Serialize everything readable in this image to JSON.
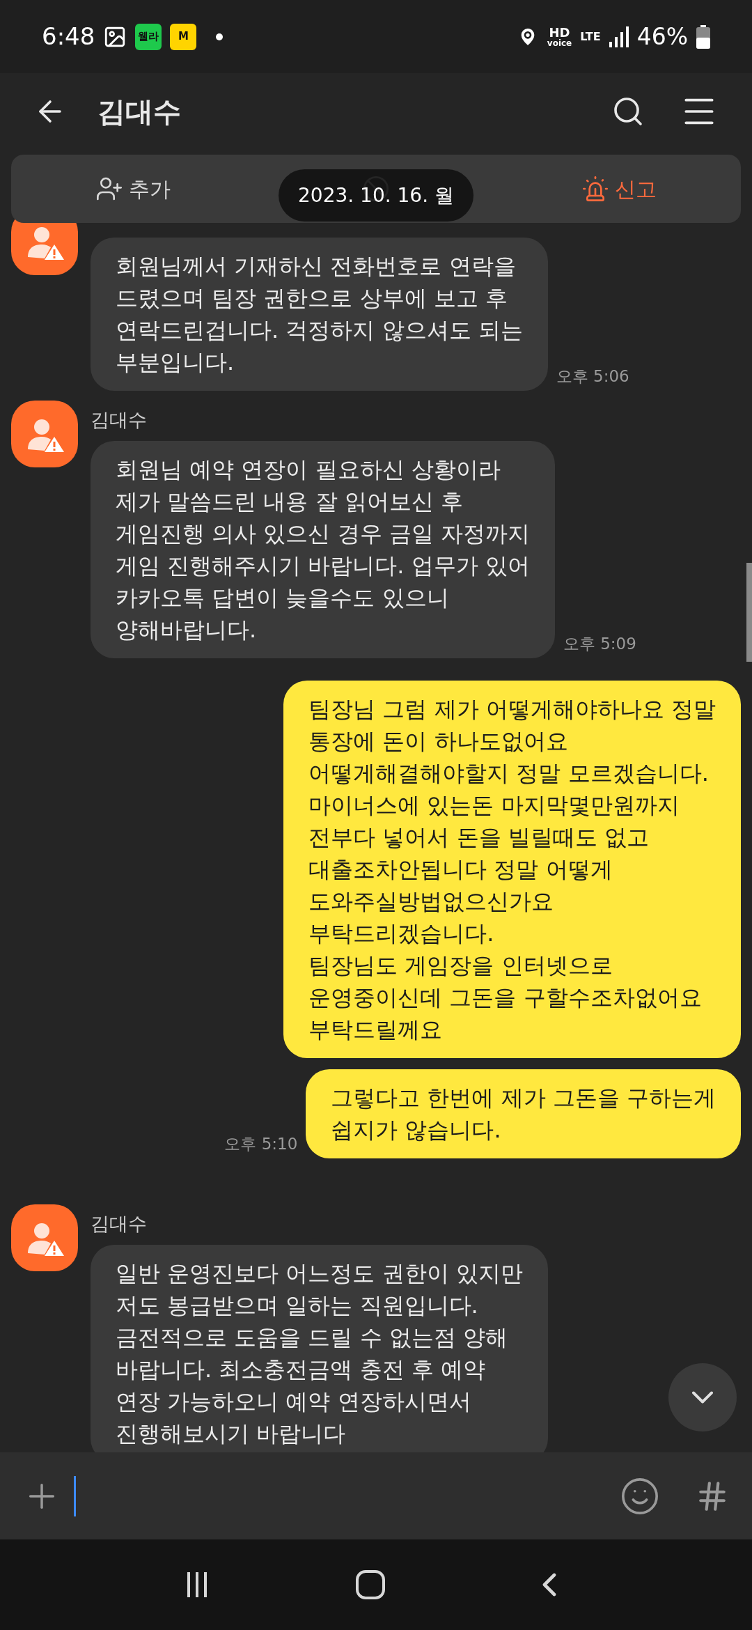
{
  "status_bar": {
    "time": "6:48",
    "notification_badges": [
      {
        "label": "웰라",
        "color": "#1ec94c"
      },
      {
        "label": "M",
        "color": "#ffd400"
      }
    ],
    "hd": "HD",
    "voice": "voice",
    "network": "LTE",
    "battery": "46%"
  },
  "header": {
    "title": "김대수"
  },
  "action_bar": [
    {
      "kind": "add",
      "label": "추가"
    },
    {
      "kind": "block"
    },
    {
      "kind": "report",
      "label": "신고"
    }
  ],
  "date_pill": "2023. 10. 16. 월",
  "messages": [
    {
      "kind": "other",
      "lines": [
        "회원님께서 기재하신 전화번호로 연락을",
        "드렸으며 팀장 권한으로 상부에 보고 후",
        "연락드린겁니다. 걱정하지 않으셔도 되는",
        "부분입니다."
      ],
      "time": "오후 5:06"
    },
    {
      "kind": "other",
      "name": "김대수",
      "lines": [
        "회원님 예약 연장이 필요하신 상황이라",
        "제가 말씀드린 내용 잘 읽어보신 후",
        "게임진행 의사 있으신 경우 금일 자정까지",
        "게임 진행해주시기 바랍니다. 업무가 있어",
        "카카오톡 답변이 늦을수도 있으니",
        "양해바랍니다."
      ],
      "time": "오후 5:09"
    },
    {
      "kind": "me",
      "lines": [
        "팀장님 그럼 제가 어떻게해야하나요 정말",
        "통장에 돈이 하나도없어요",
        "어떻게해결해야할지 정말 모르겠습니다.",
        "마이너스에 있는돈 마지막몇만원까지",
        "전부다 넣어서 돈을 빌릴때도 없고",
        "대출조차안됩니다 정말 어떻게",
        "도와주실방법없으신가요",
        "부탁드리겠습니다.",
        "팀장님도 게임장을 인터넷으로",
        "운영중이신데 그돈을 구할수조차없어요",
        "부탁드릴께요"
      ]
    },
    {
      "kind": "me",
      "lines": [
        "그렇다고 한번에 제가 그돈을 구하는게",
        "쉽지가 않습니다."
      ],
      "time": "오후 5:10"
    },
    {
      "kind": "other",
      "name": "김대수",
      "lines": [
        "일반 운영진보다 어느정도 권한이 있지만",
        "저도 봉급받으며 일하는 직원입니다.",
        "금전적으로 도움을 드릴 수 없는점 양해",
        "바랍니다. 최소충전금액 충전 후 예약",
        "연장 가능하오니 예약 연장하시면서",
        "진행해보시기 바랍니다"
      ]
    }
  ]
}
